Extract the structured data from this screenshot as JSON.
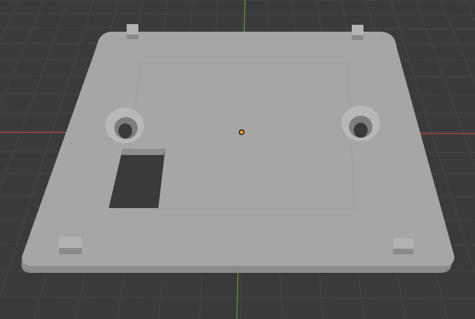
{
  "viewport": {
    "mode": "3D viewport",
    "background_color": "#3a3a3a",
    "grid_line_color": "#464646",
    "x_axis_color": "#c1453f",
    "y_axis_color": "#6a9c3a"
  },
  "model": {
    "name": "base-plate",
    "top_color": "#a6a6a6",
    "edge_color": "#8c8c8c",
    "hole_color": "#3a3a3a",
    "features": [
      "mounting-slot-left",
      "mounting-slot-right",
      "rectangular-cutout",
      "corner-peg-tl",
      "corner-peg-tr",
      "corner-peg-bl",
      "corner-peg-br"
    ]
  },
  "origin": {
    "fill_color": "#f0a12a",
    "outline_color": "#1a1a1a"
  }
}
